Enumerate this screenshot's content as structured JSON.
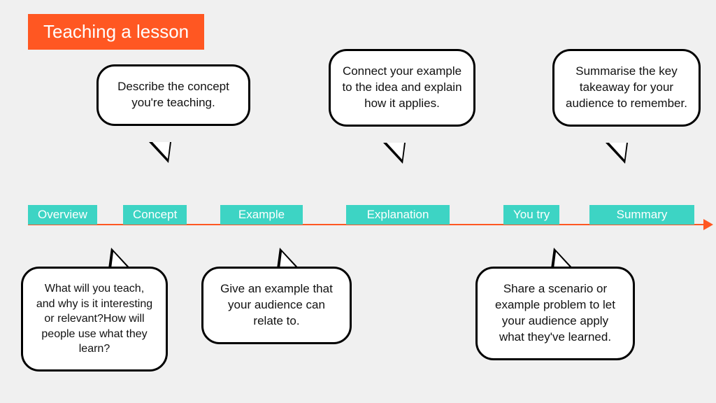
{
  "title": "Teaching a lesson",
  "steps": {
    "overview": "Overview",
    "concept": "Concept",
    "example": "Example",
    "explanation": "Explanation",
    "you_try": "You try",
    "summary": "Summary"
  },
  "bubbles": {
    "concept": "Describe the concept you're teaching.",
    "explanation": "Connect your example to the idea and explain how it applies.",
    "summary": "Summarise the key takeaway for your audience to remember.",
    "overview": "What will you teach, and why is it interesting or relevant?How will people use what they learn?",
    "example": "Give an example that your audience can relate to.",
    "you_try": "Share a scenario or example problem to let your audience apply what they've learned."
  }
}
